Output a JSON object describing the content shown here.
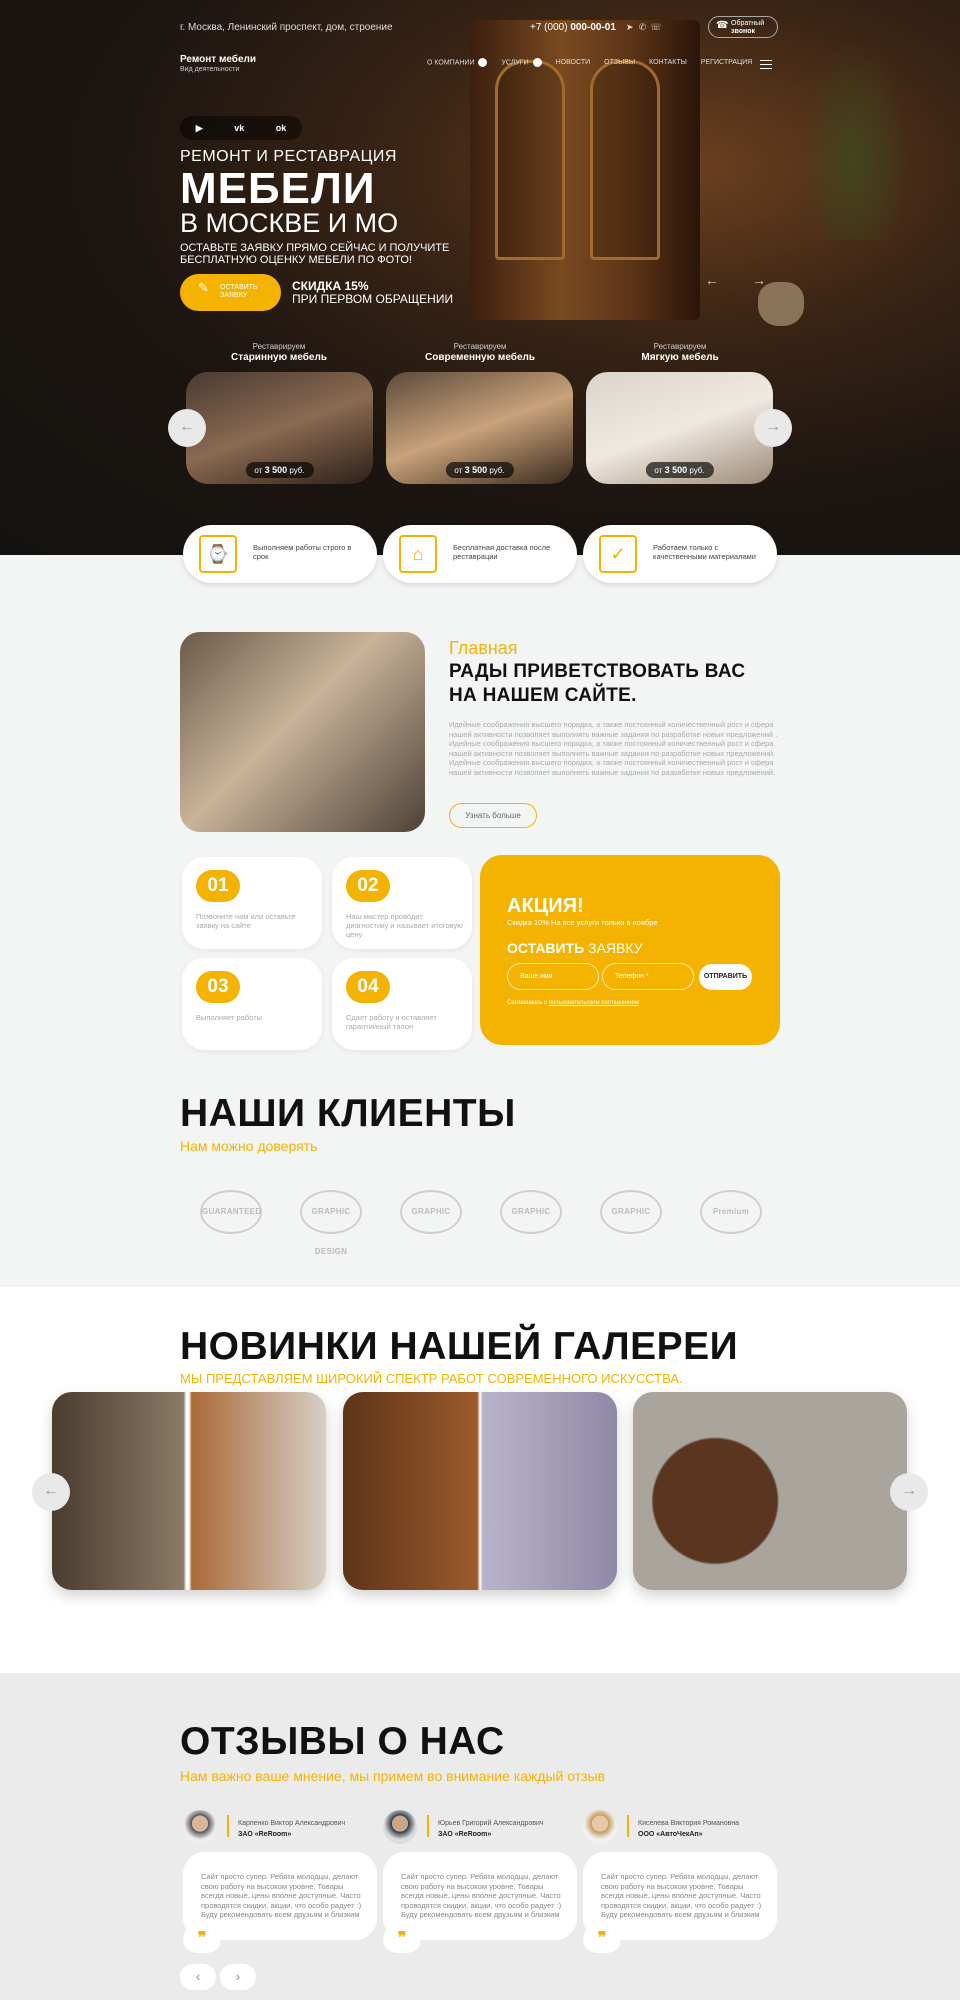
{
  "header": {
    "address": "г. Москва, Ленинский проспект, дом, строение",
    "phone_prefix": "+7 (000)",
    "phone_number": "000-00-01",
    "callback_line1": "Обратный",
    "callback_line2": "звонок",
    "logo_title": "Ремонт мебели",
    "logo_subtitle": "Вид деятельности"
  },
  "nav": {
    "items": [
      "О КОМПАНИИ",
      "УСЛУГИ",
      "НОВОСТИ",
      "ОТЗЫВЫ",
      "КОНТАКТЫ",
      "РЕГИСТРАЦИЯ"
    ]
  },
  "social": [
    "youtube-icon",
    "vk-icon",
    "odnoklassniki-icon"
  ],
  "hero": {
    "pre_title": "РЕМОНТ И РЕСТАВРАЦИЯ",
    "title": "МЕБЕЛИ",
    "subtitle": "В МОСКВЕ И МО",
    "description_line1": "ОСТАВЬТЕ ЗАЯВКУ ПРЯМО СЕЙЧАС И ПОЛУЧИТЕ",
    "description_line2": "БЕСПЛАТНУЮ ОЦЕНКУ МЕБЕЛИ ПО ФОТО!",
    "button_line1": "ОСТАВИТЬ",
    "button_line2": "ЗАЯВКУ",
    "discount_title": "СКИДКА 15%",
    "discount_text": "ПРИ ПЕРВОМ ОБРАЩЕНИИ"
  },
  "categories": [
    {
      "pre": "Реставрируем",
      "name": "Старинную мебель",
      "price_from": "от",
      "price": "3 500",
      "currency": "руб."
    },
    {
      "pre": "Реставрируем",
      "name": "Современную мебель",
      "price_from": "от",
      "price": "3 500",
      "currency": "руб."
    },
    {
      "pre": "Реставрируем",
      "name": "Мягкую мебель",
      "price_from": "от",
      "price": "3 500",
      "currency": "руб."
    }
  ],
  "features": [
    {
      "text": "Выполняем работы строго в срок"
    },
    {
      "text": "Бесплатная доставка после реставрации"
    },
    {
      "text": "Работаем только с качественными материалами"
    }
  ],
  "about": {
    "label": "Главная",
    "title_line1": "РАДЫ ПРИВЕТСТВОВАТЬ ВАС",
    "title_line2": "НА НАШЕМ САЙТЕ.",
    "text": "Идейные соображения высшего порядка, а также постоянный количественный рост и сфера нашей активности позволяет выполнять важные задания по разработке новых предложений . Идейные соображения высшего порядка, а также постоянный количественный рост и сфера нашей активности позволяет выполнять важные задания по разработке новых предложений. Идейные соображения высшего порядка, а также постоянный количественный рост и сфера нашей активности позволяет выполнять важные задания по разработке новых предложений.",
    "button": "Узнать больше"
  },
  "steps": [
    {
      "num": "01",
      "text": "Позвоните нам или оставьте заявку на сайте"
    },
    {
      "num": "02",
      "text": "Наш мастер проводит диагностику и называет итоговую цену"
    },
    {
      "num": "03",
      "text": "Выполняет работы"
    },
    {
      "num": "04",
      "text": "Сдает работу и оставляет гарантийный талон"
    }
  ],
  "promo": {
    "title": "АКЦИЯ!",
    "subtitle": "Скидка 10% На все услуги только в ноябре",
    "order_bold": "ОСТАВИТЬ",
    "order_rest": "ЗАЯВКУ",
    "name_placeholder": "Ваше имя",
    "phone_placeholder": "Телефон *",
    "submit": "ОТПРАВИТЬ",
    "agree_text": "Соглашаюсь с",
    "agree_link": "пользовательским соглашением"
  },
  "clients": {
    "title": "НАШИ КЛИЕНТЫ",
    "subtitle": "Нам можно доверять",
    "logos": [
      "GUARANTEED",
      "GRAPHIC DESIGN",
      "GRAPHIC",
      "GRAPHIC",
      "GRAPHIC",
      "Premium"
    ]
  },
  "gallery": {
    "title": "НОВИНКИ НАШЕЙ ГАЛЕРЕИ",
    "subtitle": "МЫ ПРЕДСТАВЛЯЕМ ШИРОКИЙ СПЕКТР РАБОТ СОВРЕМЕННОГО ИСКУССТВА."
  },
  "reviews": {
    "title": "ОТЗЫВЫ О НАС",
    "subtitle": "Нам важно ваше мнение, мы примем во внимание каждый отзыв",
    "items": [
      {
        "name": "Карпенко Виктор Александрович",
        "company": "ЗАО «ReRoom»",
        "text": "Сайт просто супер. Ребята молодцы, делают свою работу на высоком уровне. Товары всегда новые, цены вполне доступные. Часто проводятся скидки, акции, что особо радует :) Буду рекомендовать всем друзьям и близким"
      },
      {
        "name": "Юрьев Григорий Александрович",
        "company": "ЗАО «ReRoom»",
        "text": "Сайт просто супер. Ребята молодцы, делают свою работу на высоком уровне. Товары всегда новые, цены вполне доступные. Часто проводятся скидки, акции, что особо радует :) Буду рекомендовать всем друзьям и близким"
      },
      {
        "name": "Киселева Виктория Романовна",
        "company": "ООО «АвтоЧекАп»",
        "text": "Сайт просто супер. Ребята молодцы, делают свою работу на высоком уровне. Товары всегда новые, цены вполне доступные. Часто проводятся скидки, акции, что особо радует :) Буду рекомендовать всем друзьям и близким"
      }
    ]
  },
  "colors": {
    "accent": "#f4b300",
    "dark": "#141210",
    "light_bg": "#f3f5f4",
    "grey_bg": "#ebebeb"
  }
}
